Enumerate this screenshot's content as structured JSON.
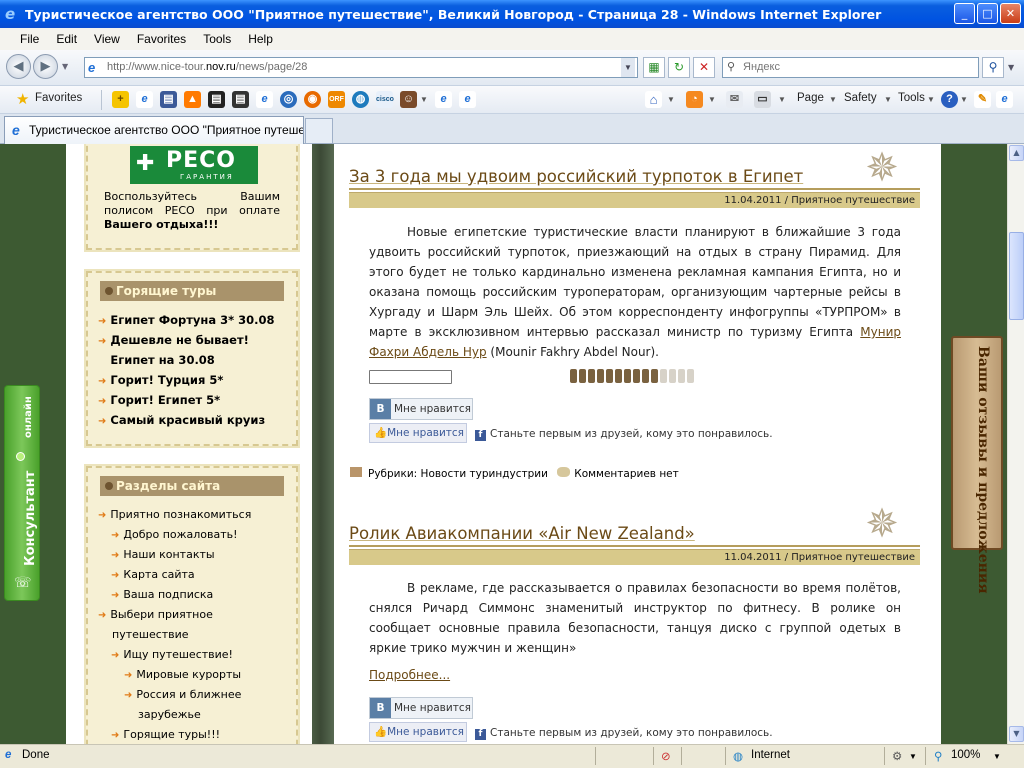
{
  "window": {
    "title": "Туристическое агентство ООО \"Приятное путешествие\", Великий Новгород - Страница 28 - Windows Internet Explorer",
    "min": "_",
    "max": "□",
    "close": "✕"
  },
  "menu": [
    "File",
    "Edit",
    "View",
    "Favorites",
    "Tools",
    "Help"
  ],
  "address": {
    "prefix": "http://www.nice-tour.",
    "domain": "nov.ru",
    "suffix": "/news/page/28",
    "search_placeholder": "Яндекс"
  },
  "favorites": {
    "label": "Favorites",
    "commands": [
      "Page",
      "Safety",
      "Tools"
    ]
  },
  "tab": {
    "title": "Туристическое агентство ООО \"Приятное путеше..."
  },
  "sidebar": {
    "reso_logo": "РЕСО",
    "reso_sub": "ГАРАНТИЯ",
    "reso_text_1": "Воспользуйтесь Вашим",
    "reso_text_2": "полисом РЕСО при оплате",
    "reso_text_3": "Вашего отдыха!!!",
    "hot_title": "Горящие туры",
    "hot_items": [
      "Египет Фортуна 3* 30.08",
      "Дешевле не бывает!",
      "Египет на 30.08",
      "Горит! Турция 5*",
      "Горит! Египет 5*",
      "Самый красивый круиз"
    ],
    "sections_title": "Разделы сайта",
    "sections": [
      {
        "label": "Приятно познакомиться",
        "level": 0
      },
      {
        "label": "Добро пожаловать!",
        "level": 1
      },
      {
        "label": "Наши контакты",
        "level": 1
      },
      {
        "label": "Карта сайта",
        "level": 1
      },
      {
        "label": "Ваша подписка",
        "level": 1
      },
      {
        "label": "Выбери приятное",
        "level": 0
      },
      {
        "label": "путешествие",
        "level": 0,
        "cont": true
      },
      {
        "label": "Ищу путешествие!",
        "level": 1
      },
      {
        "label": "Мировые курорты",
        "level": 2
      },
      {
        "label": "Россия и ближнее",
        "level": 2
      },
      {
        "label": "зарубежье",
        "level": 2,
        "cont": true
      },
      {
        "label": "Горящие туры!!!",
        "level": 1
      }
    ]
  },
  "posts": [
    {
      "title": "За 3 года мы удвоим российский турпоток в Египет",
      "meta": "11.04.2011 / Приятное путешествие",
      "body": "Новые египетские туристические власти планируют в ближайшие 3 года удвоить российский турпоток, приезжающий на отдых в страну Пирамид. Для этого будет не только кардинально изменена рекламная кампания Египта, но и оказана помощь российским туроператорам, организующим чартерные рейсы в Хургаду и Шарм Эль Шейх. Об этом корреспонденту инфогруппы «ТУРПРОМ» в марте в эксклюзивном интервью рассказал министр по туризму Египта ",
      "link": "Мунир Фахри Абдель Нур",
      "body_end": " (Mounir Fakhry Abdel Nour).",
      "rating_filled": 10,
      "rating_total": 14,
      "vk_like": "Мне нравится",
      "fb_like": "Мне нравится",
      "fb_text": "Станьте первым из друзей, кому это понравилось.",
      "rubric_label": "Рубрики: Новости туриндустрии",
      "comments": "Комментариев нет"
    },
    {
      "title": "Ролик Авиакомпании «Air New Zealand»",
      "meta": "11.04.2011 / Приятное путешествие",
      "body": "В рекламе, где рассказывается о правилах безопасности во время полётов, снялся Ричард Симмонс знаменитый инструктор по фитнесу. В ролике он сообщает основные правила безопасности, танцуя диско с группой одетых в яркие трико мужчин и женщин»",
      "more": "Подробнее...",
      "vk_like": "Мне нравится",
      "fb_like": "Мне нравится",
      "fb_text": "Станьте первым из друзей, кому это понравилось."
    }
  ],
  "widgets": {
    "consultant": "Консультант",
    "online": "онлайн",
    "reviews": "Ваши отзывы и предложения"
  },
  "status": {
    "text": "Done",
    "zone": "Internet",
    "zoom": "100%"
  }
}
